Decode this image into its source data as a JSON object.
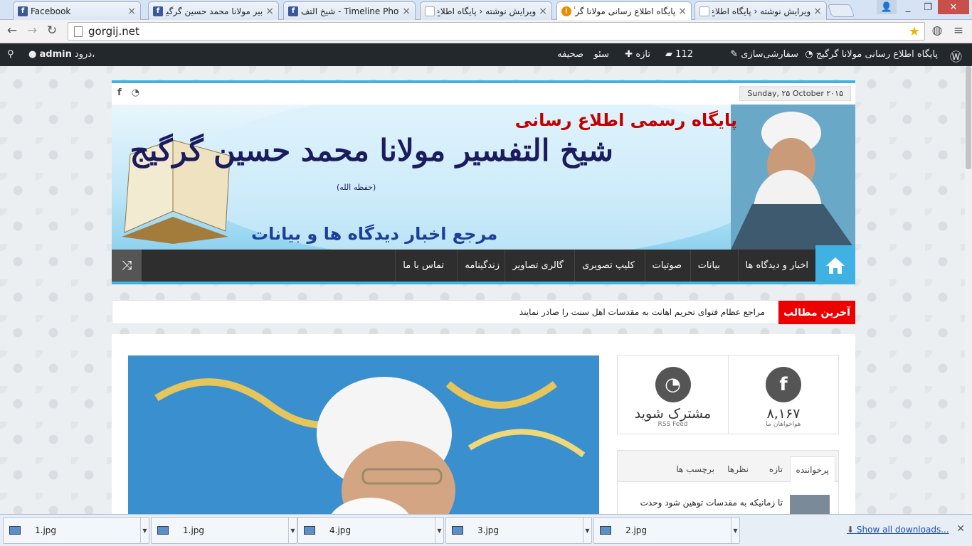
{
  "browser": {
    "tabs": [
      {
        "title": "Facebook",
        "favicon": "facebook-icon",
        "active": false
      },
      {
        "title": "بیر مولانا محمد حسین گرگیج",
        "favicon": "facebook-icon",
        "active": false
      },
      {
        "title": "شیخ التف - Timeline Photos",
        "favicon": "facebook-icon",
        "active": false
      },
      {
        "title": "ویرایش نوشته ‹ پایگاه اطلاع",
        "favicon": "page-icon",
        "active": false
      },
      {
        "title": "پایگاه اطلاع رسانی مولانا گرگ",
        "favicon": "warning-icon",
        "active": true
      },
      {
        "title": "ویرایش نوشته ‹ پایگاه اطلاع",
        "favicon": "page-icon",
        "active": false
      }
    ],
    "address": "gorgij.net",
    "window_buttons": [
      "_",
      "❐",
      "✕"
    ]
  },
  "wpbar": {
    "site_name": "پایگاه اطلاع رسانی مولانا گرگیج",
    "customize": "سفارشی‌سازی",
    "comments": "112",
    "new": "تازه",
    "seo": "سئو",
    "page": "صحیفه",
    "greeting": "درود،",
    "user": "admin"
  },
  "header": {
    "date": "Sunday, ۲۵ October ۲۰۱۵",
    "banner_title_small": "پایگاه رسمی اطلاع رسانی",
    "banner_title_large": "شیخ التفسیر مولانا محمد حسین گرگیج",
    "banner_honorific": "(حفظه الله)",
    "banner_tagline": "مرجع اخبار دیدگاه ها و بیانات"
  },
  "menu": {
    "items": [
      "اخبار و دیدگاه ها",
      "بیانات",
      "صوتیات",
      "کلیپ تصویری",
      "گالری تصاویر",
      "زندگینامه",
      "تماس با ما"
    ]
  },
  "ticker": {
    "label": "آخرین مطالب",
    "text": "مراجع عظام فتوای تحریم اهانت به مقدسات اهل سنت را صادر نمایند"
  },
  "widget_social": {
    "facebook_count": "۸,۱۶۷",
    "facebook_caption": "هواخواهان ما",
    "rss_title": "مشترک شوید",
    "rss_caption": "RSS Feed"
  },
  "widget_tabs": {
    "tabs": [
      "پرخواننده",
      "تازه",
      "نظرها",
      "برچسب ها"
    ],
    "first_post": "تا زمانیکه به مقدسات توهین شود وحدت"
  },
  "downloads": {
    "files": [
      "1.jpg",
      "1.jpg",
      "4.jpg",
      "3.jpg",
      "2.jpg"
    ],
    "show_all": "Show all downloads..."
  }
}
